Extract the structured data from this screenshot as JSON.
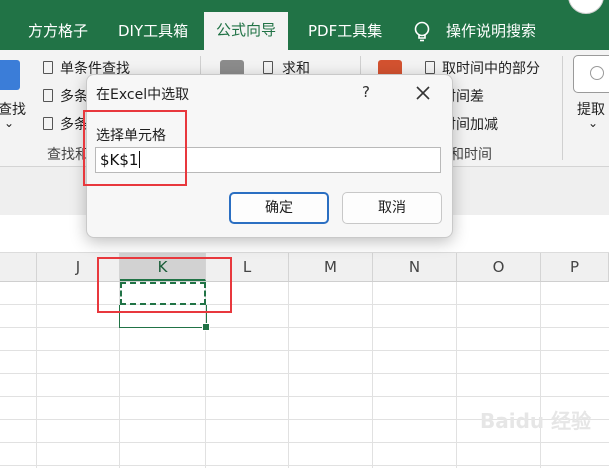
{
  "tabs": [
    {
      "label": "方方格子",
      "active": false
    },
    {
      "label": "DIY工具箱",
      "active": false
    },
    {
      "label": "公式向导",
      "active": true
    },
    {
      "label": "PDF工具集",
      "active": false
    },
    {
      "label": "操作说明搜索",
      "active": false
    }
  ],
  "ribbon": {
    "find_label": "查找",
    "find_chevron": "⌄",
    "cond_find": "单条件查找",
    "multi_1": "多条",
    "multi_2": "多条",
    "find_group": "查找和",
    "sum": "求和",
    "time_part": "取时间中的部分",
    "time_diff": "时间差",
    "time_add": "时间加减",
    "time_group": "和时间",
    "extract": "提取",
    "extract_chevron": "⌄"
  },
  "columns": [
    "J",
    "K",
    "L",
    "M",
    "N",
    "O",
    "P"
  ],
  "selected_column": "K",
  "dialog": {
    "title": "在Excel中选取",
    "help": "?",
    "label": "选择单元格",
    "value": "$K$1",
    "ok": "确定",
    "cancel": "取消"
  },
  "watermark": "Baidu 经验",
  "colors": {
    "accent": "#217346",
    "annotation": "#e8383d",
    "button_focus": "#2b6fc2"
  }
}
